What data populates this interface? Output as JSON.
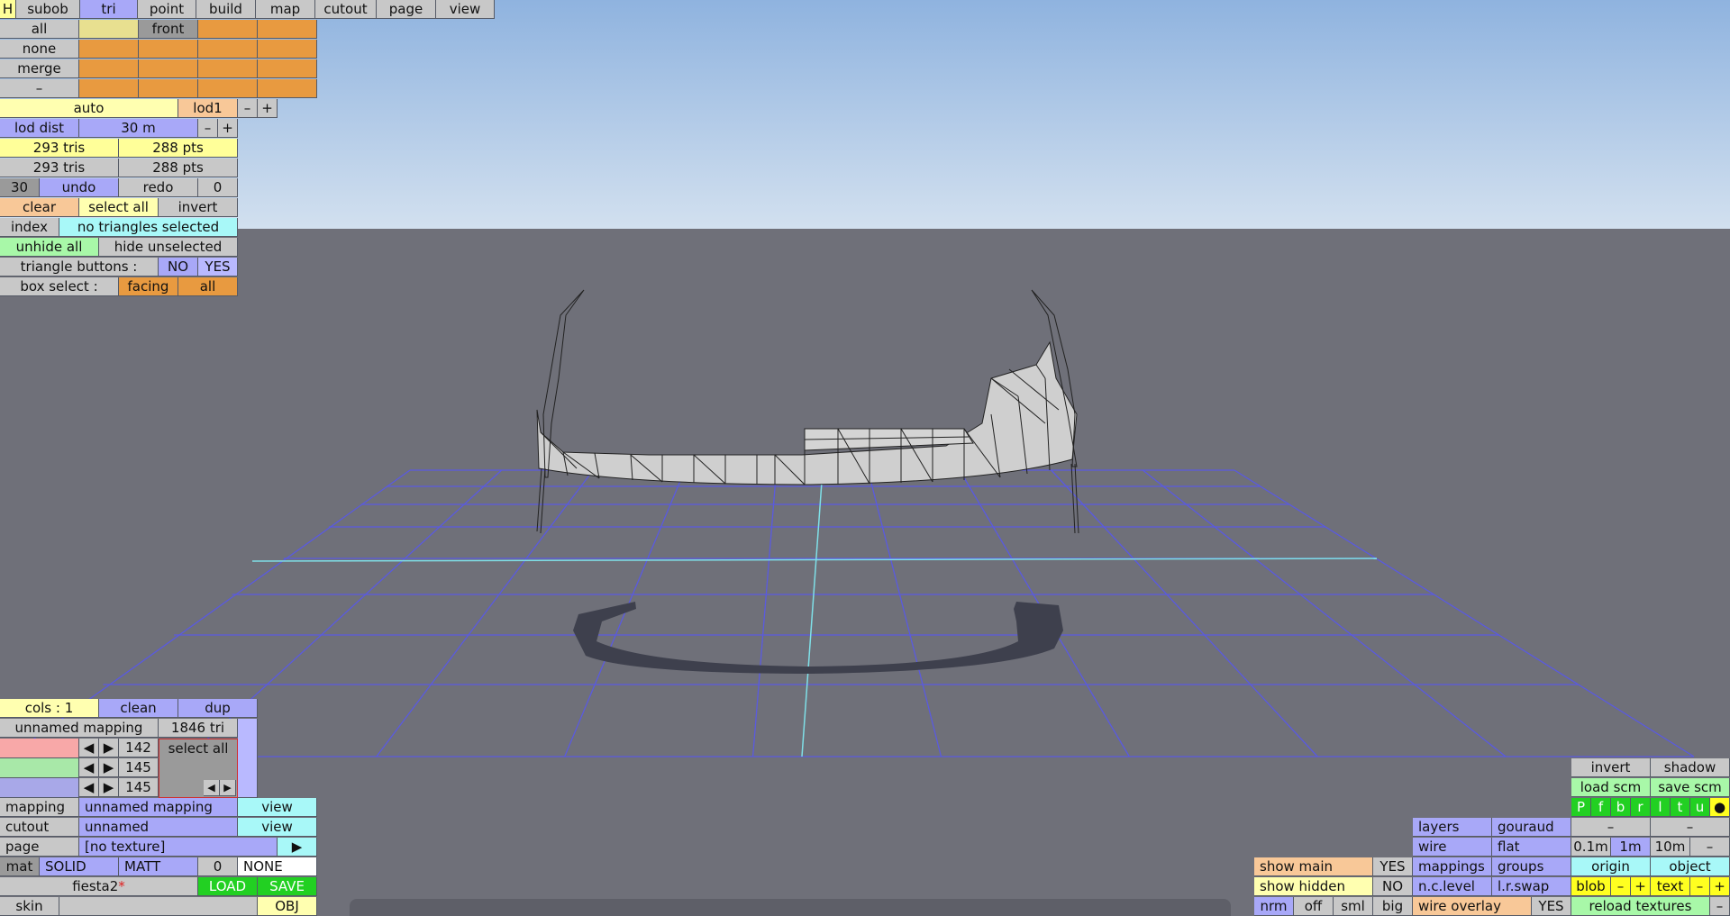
{
  "top_menu": [
    "H",
    "subob",
    "tri",
    "point",
    "build",
    "map",
    "cutout",
    "page",
    "view"
  ],
  "select_rows": [
    "all",
    "none",
    "merge",
    "–"
  ],
  "front_label": "front",
  "lod": {
    "auto": "auto",
    "name": "lod1",
    "minus": "–",
    "plus": "+"
  },
  "lod_dist": {
    "label": "lod dist",
    "value": "30 m",
    "minus": "–",
    "plus": "+"
  },
  "stats": [
    [
      "293 tris",
      "288 pts"
    ],
    [
      "293 tris",
      "288 pts"
    ]
  ],
  "undo": {
    "count": "30",
    "undo": "undo",
    "redo": "redo",
    "redo_count": "0"
  },
  "selection": {
    "clear": "clear",
    "select_all": "select all",
    "invert": "invert"
  },
  "index": {
    "label": "index",
    "value": "no triangles selected"
  },
  "hide": {
    "unhide_all": "unhide all",
    "hide_unselected": "hide unselected"
  },
  "tri_buttons": {
    "label": "triangle buttons :",
    "no": "NO",
    "yes": "YES"
  },
  "box_select": {
    "label": "box select :",
    "facing": "facing",
    "all": "all"
  },
  "mapping_panel": {
    "cols": "cols : 1",
    "clean": "clean",
    "dup": "dup",
    "mapping_name": "unnamed mapping",
    "tri_count": "1846 tri",
    "rgb": [
      "142",
      "145",
      "145"
    ],
    "select_all": "select all"
  },
  "mapping_row": {
    "label": "mapping",
    "value": "unnamed mapping",
    "view": "view"
  },
  "cutout_row": {
    "label": "cutout",
    "value": "unnamed",
    "view": "view"
  },
  "page_row": {
    "label": "page",
    "value": "[no texture]",
    "play": "▶"
  },
  "mat_row": {
    "mat": "mat",
    "solid": "SOLID",
    "matt": "MATT",
    "num": "0",
    "none": "NONE"
  },
  "file_row": {
    "name": "fiesta2",
    "modified_mark": "*",
    "load": "LOAD",
    "save": "SAVE"
  },
  "skin_row": {
    "skin": "skin",
    "obj": "OBJ"
  },
  "right_panel": {
    "invert": "invert",
    "shadow": "shadow",
    "load_scm": "load scm",
    "save_scm": "save scm",
    "view_letters": [
      "P",
      "f",
      "b",
      "r",
      "l",
      "t",
      "u",
      "●"
    ],
    "minus": "–",
    "layers": "layers",
    "gouraud": "gouraud",
    "wire": "wire",
    "flat": "flat",
    "grid_sizes": [
      "0.1m",
      "1m",
      "10m"
    ],
    "mappings": "mappings",
    "groups": "groups",
    "origin": "origin",
    "object": "object",
    "n_c_level": "n.c.level",
    "l_r_swap": "l.r.swap",
    "blob": "blob",
    "text": "text",
    "plus": "+",
    "wire_overlay": "wire overlay",
    "wire_overlay_val": "YES",
    "reload_textures": "reload textures"
  },
  "bottom_left_panel": {
    "show_main": "show main",
    "show_main_val": "YES",
    "show_hidden": "show hidden",
    "show_hidden_val": "NO",
    "nrm": "nrm",
    "off": "off",
    "sml": "sml",
    "big": "big"
  },
  "colors": {
    "sky_top": "#8fb3df",
    "sky_bottom": "#d2e0ef",
    "ground": "#6f7079",
    "grid": "#5a5ae0",
    "axis": "#7fe0e8"
  }
}
